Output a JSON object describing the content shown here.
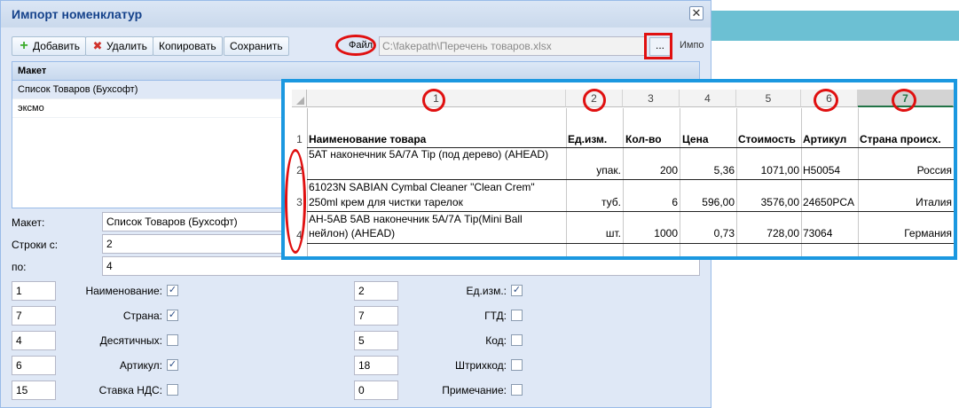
{
  "dialog": {
    "title": "Импорт номенклатур",
    "close_glyph": "✕"
  },
  "toolbar": {
    "add": "Добавить",
    "delete": "Удалить",
    "copy": "Копировать",
    "save": "Сохранить"
  },
  "file": {
    "label": "Файл:",
    "value": "C:\\fakepath\\Перечень товаров.xlsx",
    "browse": "...",
    "import": "Импо"
  },
  "templates": {
    "header": "Макет",
    "items": [
      "Список Товаров (Бухсофт)",
      "эксмо"
    ]
  },
  "form": {
    "template_label": "Макет:",
    "template_value": "Список Товаров (Бухсофт)",
    "rows_from_label": "Строки с:",
    "rows_from_value": "2",
    "rows_to_label": "по:",
    "rows_to_value": "4"
  },
  "columns_left": [
    {
      "value": "1",
      "label": "Наименование:",
      "checked": true
    },
    {
      "value": "7",
      "label": "Страна:",
      "checked": true
    },
    {
      "value": "4",
      "label": "Десятичных:",
      "checked": false
    },
    {
      "value": "6",
      "label": "Артикул:",
      "checked": true
    },
    {
      "value": "15",
      "label": "Ставка НДС:",
      "checked": false
    }
  ],
  "columns_right": [
    {
      "value": "2",
      "label": "Ед.изм.:",
      "checked": true
    },
    {
      "value": "7",
      "label": "ГТД:",
      "checked": false
    },
    {
      "value": "5",
      "label": "Код:",
      "checked": false
    },
    {
      "value": "18",
      "label": "Штрихкод:",
      "checked": false
    },
    {
      "value": "0",
      "label": "Примечание:",
      "checked": false
    }
  ],
  "sheet": {
    "column_numbers": [
      "1",
      "2",
      "3",
      "4",
      "5",
      "6",
      "7"
    ],
    "row_numbers": [
      "1",
      "2",
      "3",
      "4"
    ],
    "headers": [
      "Наименование товара",
      "Ед.изм.",
      "Кол-во",
      "Цена",
      "Стоимость",
      "Артикул",
      "Страна происх."
    ],
    "rows": [
      {
        "name1": "5AT наконечник 5А/7А Tip (под дерево) (AHEAD)",
        "name2": "",
        "unit": "упак.",
        "qty": "200",
        "price": "5,36",
        "cost": "1071,00",
        "article": "H50054",
        "country": "Россия"
      },
      {
        "name1": "61023N SABIAN Cymbal Cleaner  \"Clean Crem\"",
        "name2": "250ml крем для чистки тарелок",
        "unit": "туб.",
        "qty": "6",
        "price": "596,00",
        "cost": "3576,00",
        "article": "24650PCA",
        "country": "Италия"
      },
      {
        "name1": "AH-5AB  5AB наконечник 5А/7А Tip(Mini Ball",
        "name2": "нейлон) (AHEAD)",
        "unit": "шт.",
        "qty": "1000",
        "price": "0,73",
        "cost": "728,00",
        "article": "73064",
        "country": "Германия"
      }
    ]
  },
  "colors": {
    "annotation": "#e01010",
    "overlay_border": "#1b98e0",
    "window_bg": "#dfe8f6"
  }
}
